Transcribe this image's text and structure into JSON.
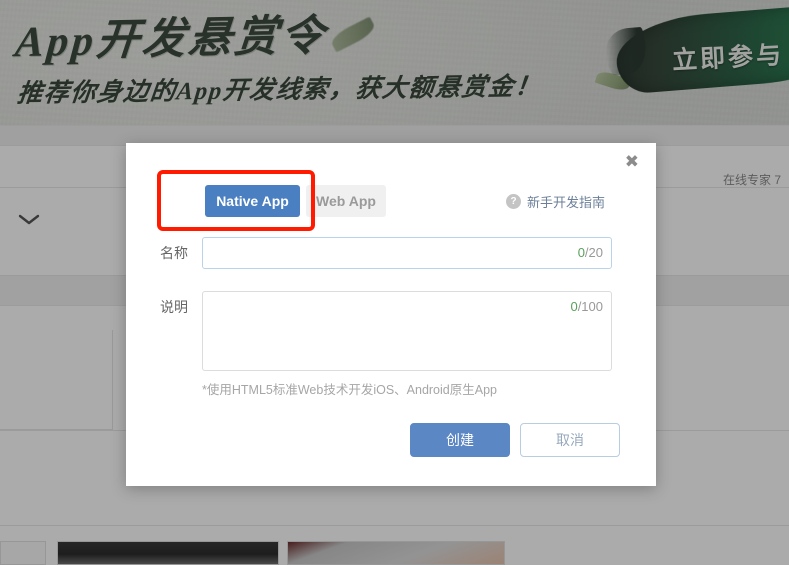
{
  "banner": {
    "title": "App开发悬赏令",
    "subtitle": "推荐你身边的App开发线索，获大额悬赏金！",
    "cta": "立即参与"
  },
  "background": {
    "expert_status": "在线专家 7",
    "chevron_icon": "chevron-down-icon"
  },
  "modal": {
    "close_icon": "✖",
    "tabs": [
      {
        "label": "Native App",
        "active": true
      },
      {
        "label": "Web App",
        "active": false
      }
    ],
    "guide": {
      "icon_char": "?",
      "label": "新手开发指南"
    },
    "fields": {
      "name": {
        "label": "名称",
        "value": "",
        "placeholder": "",
        "count_current": "0",
        "count_max": "/20"
      },
      "description": {
        "label": "说明",
        "value": "",
        "placeholder": "",
        "count_current": "0",
        "count_max": "/100"
      }
    },
    "hint": "*使用HTML5标准Web技术开发iOS、Android原生App",
    "buttons": {
      "confirm": "创建",
      "cancel": "取消"
    },
    "accent_color": "#4a7fc1",
    "highlight_color": "#ff1a00"
  }
}
